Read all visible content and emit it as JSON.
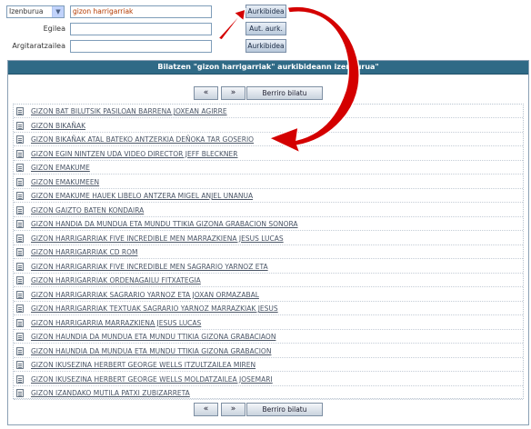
{
  "search": {
    "field_select": "Izenburua",
    "query_value": "gizon harrigarriak",
    "author_label": "Egilea",
    "author_value": "",
    "publisher_label": "Argitaratzailea",
    "publisher_value": "",
    "search_button": "Aurkibidea",
    "author_index_button": "Aut. aurk.",
    "publisher_index_button": "Aurkibidea"
  },
  "panel": {
    "title": "Bilatzen \"gizon harrigarriak\" aurkibideann izenburua\"",
    "prev_label": "«",
    "next_label": "»",
    "retry_label": "Berriro bilatu"
  },
  "results": [
    "GIZON BAT BILUTSIK PASILOAN BARRENA JOXEAN AGIRRE",
    "GIZON BIKAÑAK",
    "GIZON BIKAÑAK ATAL BATEKO ANTZERKIA DEÑOKA TAR GOSERIO",
    "GIZON EGIN NINTZEN UDA VIDEO DIRECTOR JEFF BLECKNER",
    "GIZON EMAKUME",
    "GIZON EMAKUMEEN",
    "GIZON EMAKUME HAUEK LIBELO ANTZERA MIGEL ANJEL UNANUA",
    "GIZON GAIZTO BATEN KONDAIRA",
    "GIZON HANDIA DA MUNDUA ETA MUNDU TTIKIA GIZONA GRABACION SONORA",
    "GIZON HARRIGARRIAK FIVE INCREDIBLE MEN MARRAZKIENA JESUS LUCAS",
    "GIZON HARRIGARRIAK CD ROM",
    "GIZON HARRIGARRIAK FIVE INCREDIBLE MEN SAGRARIO YARNOZ ETA",
    "GIZON HARRIGARRIAK ORDENAGAILU FITXATEGIA",
    "GIZON HARRIGARRIAK SAGRARIO YARNOZ ETA JOXAN ORMAZABAL",
    "GIZON HARRIGARRIAK TEXTUAK SAGRARIO YARNOZ MARRAZKIAK JESUS",
    "GIZON HARRIGARRIA MARRAZKIENA JESUS LUCAS",
    "GIZON HAUNDIA DA MUNDUA ETA MUNDU TTIKIA GIZONA GRABACIAON",
    "GIZON HAUNDIA DA MUNDUA ETA MUNDU TTIKIA GIZONA GRABACION",
    "GIZON IKUSEZINA HERBERT GEORGE WELLS ITZULTZAILEA MIREN",
    "GIZON IKUSEZINA HERBERT GEORGE WELLS MOLDATZAILEA JOSEMARI",
    "GIZON IZANDAKO MUTILA PATXI ZUBIZARRETA"
  ],
  "colors": {
    "header_bg": "#2f6a86",
    "annotation_arrow": "#cc0000"
  }
}
